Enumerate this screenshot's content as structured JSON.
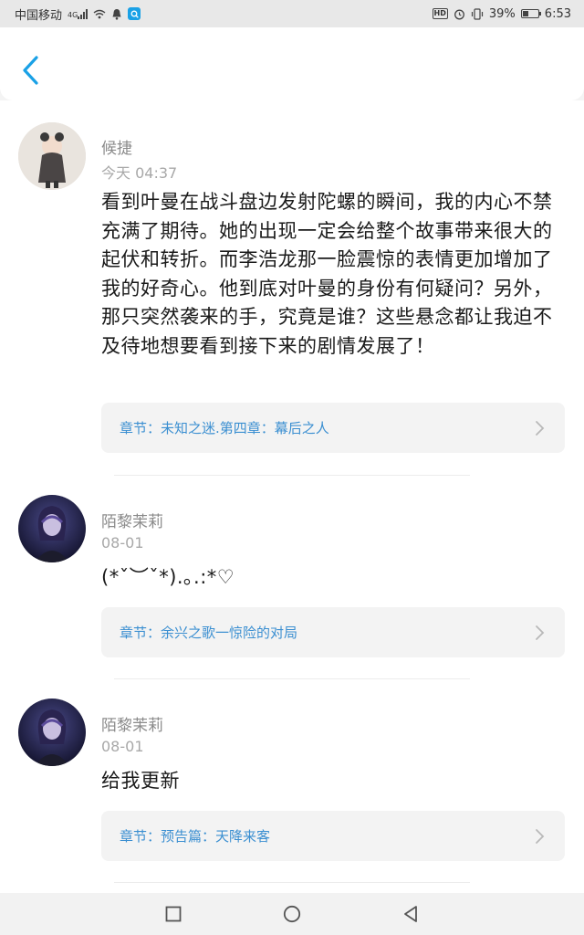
{
  "status_bar": {
    "carrier": "中国移动",
    "network": "4G",
    "battery": "39%",
    "battery_level": 0.39,
    "time": "6:53",
    "hd_label": "HD"
  },
  "comments": [
    {
      "author": "候捷",
      "time": "今天 04:37",
      "text": "看到叶曼在战斗盘边发射陀螺的瞬间，我的内心不禁充满了期待。她的出现一定会给整个故事带来很大的起伏和转折。而李浩龙那一脸震惊的表情更加增加了我的好奇心。他到底对叶曼的身份有何疑问？另外，那只突然袭来的手，究竟是谁？这些悬念都让我迫不及待地想要看到接下来的剧情发展了！",
      "chapter": "章节：未知之迷.第四章：幕后之人"
    },
    {
      "author": "陌黎茉莉",
      "time": "08-01",
      "text": "(*ˇ︶ˇ*).｡.:*♡",
      "chapter": "章节：余兴之歌一惊险的对局"
    },
    {
      "author": "陌黎茉莉",
      "time": "08-01",
      "text": "给我更新",
      "chapter": "章节：预告篇：天降来客"
    }
  ],
  "colors": {
    "accent": "#1aa1e6",
    "chapter_link": "#3b8fd1"
  }
}
